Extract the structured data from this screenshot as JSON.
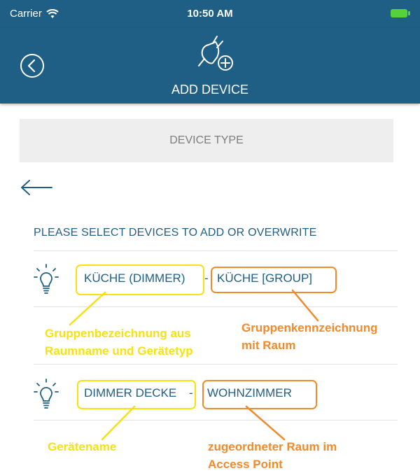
{
  "status_bar": {
    "carrier": "Carrier",
    "time": "10:50 AM"
  },
  "header": {
    "title": "ADD DEVICE"
  },
  "device_type": {
    "label": "DEVICE TYPE"
  },
  "section": {
    "heading": "PLEASE SELECT DEVICES TO ADD OR OVERWRITE"
  },
  "devices": [
    {
      "name": "KÜCHE (DIMMER)",
      "separator": " - ",
      "room": "KÜCHE [GROUP]"
    },
    {
      "name": "DIMMER DECKE",
      "separator": " - ",
      "room": "WOHNZIMMER"
    }
  ],
  "annotations": {
    "group_name_line1": "Gruppenbezeichnung aus",
    "group_name_line2": "Raumname und Gerätetyp",
    "group_id_line1": "Gruppenkennzeichnung",
    "group_id_line2": "mit Raum",
    "device_name": "Gerätename",
    "assigned_room_line1": "zugeordneter Raum im",
    "assigned_room_line2": "Access Point"
  },
  "colors": {
    "header_bg": "#1f5f86",
    "highlight_yellow": "#f5e212",
    "highlight_orange": "#f08a2c"
  }
}
